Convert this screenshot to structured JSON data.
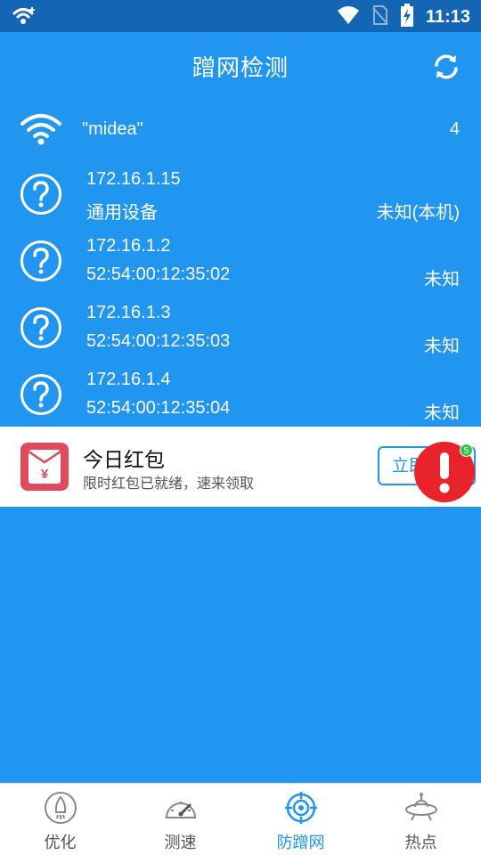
{
  "status_bar": {
    "time": "11:13"
  },
  "header": {
    "title": "蹭网检测"
  },
  "network": {
    "ssid": "\"midea\"",
    "device_count": "4"
  },
  "devices": [
    {
      "ip": "172.16.1.15",
      "sub": "通用设备",
      "type": "未知(本机)"
    },
    {
      "ip": "172.16.1.2",
      "sub": "52:54:00:12:35:02",
      "type": "未知"
    },
    {
      "ip": "172.16.1.3",
      "sub": "52:54:00:12:35:03",
      "type": "未知"
    },
    {
      "ip": "172.16.1.4",
      "sub": "52:54:00:12:35:04",
      "type": "未知"
    }
  ],
  "ad": {
    "title": "今日红包",
    "subtitle": "限时红包已就绪，速来领取",
    "button_label": "立即领取",
    "icon_symbol": "¥",
    "alert_count": "5"
  },
  "bottom_nav": [
    {
      "label": "优化",
      "icon": "rocket-icon"
    },
    {
      "label": "测速",
      "icon": "speedometer-icon"
    },
    {
      "label": "防蹭网",
      "icon": "target-icon"
    },
    {
      "label": "热点",
      "icon": "ufo-icon"
    }
  ],
  "colors": {
    "primary": "#2196f0",
    "status_bar": "#1565b5",
    "alert_red": "#e8232a",
    "ad_icon": "#e04a5c"
  }
}
